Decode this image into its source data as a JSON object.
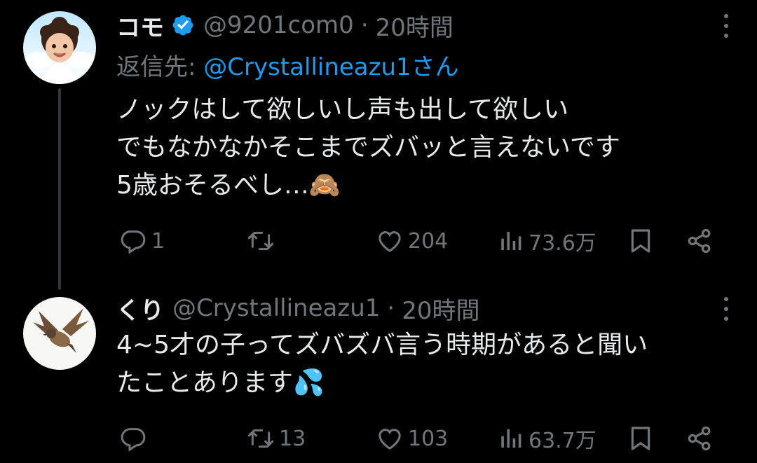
{
  "tweets": [
    {
      "name": "コモ",
      "handle": "@9201com0",
      "separator": "·",
      "time": "20時間",
      "reply_to_label": "返信先:",
      "reply_to_handle": "@Crystallineazu1さん",
      "lines": [
        "ノックはして欲しいし声も出して欲しい",
        "でもなかなかそこまでズバッと言えないです",
        "5歳おそるべし…🙈"
      ],
      "actions": {
        "replies": "1",
        "retweets": "",
        "likes": "204",
        "views": "73.6万"
      },
      "icons": [
        "verified-badge-icon",
        "more-options-icon",
        "reply-icon",
        "retweet-icon",
        "like-icon",
        "views-icon",
        "bookmark-icon",
        "share-icon"
      ],
      "avatar": "baby-with-wings-avatar"
    },
    {
      "name": "くり",
      "handle": "@Crystallineazu1",
      "separator": "·",
      "time": "20時間",
      "lines": [
        "4~5才の子ってズバズバ言う時期があると聞い",
        "たことあります💦"
      ],
      "actions": {
        "replies": "",
        "retweets": "13",
        "likes": "103",
        "views": "63.7万"
      },
      "icons": [
        "more-options-icon",
        "reply-icon",
        "retweet-icon",
        "like-icon",
        "views-icon",
        "bookmark-icon",
        "share-icon"
      ],
      "avatar": "flying-sparrow-avatar"
    }
  ],
  "colors": {
    "background": "#000000",
    "text": "#e7e9ea",
    "secondary": "#71767b",
    "accent": "#1d9bf0",
    "thread_line": "#333639"
  }
}
